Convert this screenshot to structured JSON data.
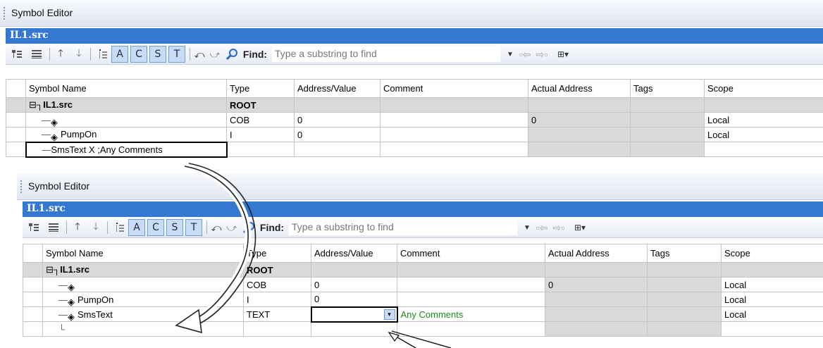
{
  "panel_top": {
    "header_title": "Symbol Editor",
    "file_tab": "IL1.src",
    "toolbar": {
      "letters": [
        "A",
        "C",
        "S",
        "T"
      ],
      "find_label": "Find:",
      "find_placeholder": "Type a substring to find"
    },
    "columns": [
      "Symbol Name",
      "Type",
      "Address/Value",
      "Comment",
      "Actual Address",
      "Tags",
      "Scope"
    ],
    "rows": [
      {
        "name": "IL1.src",
        "type": "ROOT",
        "address": "",
        "comment": "",
        "actual": "",
        "tags": "",
        "scope": ""
      },
      {
        "name": "",
        "type": "COB",
        "address": "0",
        "comment": "",
        "actual": "0",
        "tags": "",
        "scope": "Local"
      },
      {
        "name": "PumpOn",
        "type": "I",
        "address": "0",
        "comment": "",
        "actual": "",
        "tags": "",
        "scope": "Local"
      },
      {
        "name": "SmsText X ;Any Comments",
        "type": "",
        "address": "",
        "comment": "",
        "actual": "",
        "tags": "",
        "scope": ""
      }
    ]
  },
  "panel_bottom": {
    "header_title": "Symbol Editor",
    "file_tab": "IL1.src",
    "toolbar": {
      "letters": [
        "A",
        "C",
        "S",
        "T"
      ],
      "find_label": "Find:",
      "find_placeholder": "Type a substring to find"
    },
    "columns": [
      "Symbol Name",
      "Type",
      "Address/Value",
      "Comment",
      "Actual Address",
      "Tags",
      "Scope"
    ],
    "rows": [
      {
        "name": "IL1.src",
        "type": "ROOT",
        "address": "",
        "comment": "",
        "actual": "",
        "tags": "",
        "scope": ""
      },
      {
        "name": "",
        "type": "COB",
        "address": "0",
        "comment": "",
        "actual": "0",
        "tags": "",
        "scope": "Local"
      },
      {
        "name": "PumpOn",
        "type": "I",
        "address": "0",
        "comment": "",
        "actual": "",
        "tags": "",
        "scope": "Local"
      },
      {
        "name": "SmsText",
        "type": "TEXT",
        "address": "",
        "comment": "Any Comments",
        "actual": "",
        "tags": "",
        "scope": "Local"
      },
      {
        "name": "",
        "type": "",
        "address": "",
        "comment": "",
        "actual": "",
        "tags": "",
        "scope": ""
      }
    ]
  },
  "colors": {
    "file_tab_bg": "#3478d1",
    "grey_cell": "#d9d9d9",
    "comment_green": "#1a8c1a",
    "letter_btn_bg": "#c9dcf6"
  },
  "icons": [
    "tree-view-icon",
    "list-view-icon",
    "arrow-up-icon",
    "arrow-down-icon",
    "insert-row-icon",
    "undo-icon",
    "redo-icon",
    "find-magnifier-icon",
    "dropdown-arrow-icon",
    "find-prev-icon",
    "find-next-icon",
    "expand-icon",
    "symbol-icon",
    "curved-arrow-annotation"
  ]
}
